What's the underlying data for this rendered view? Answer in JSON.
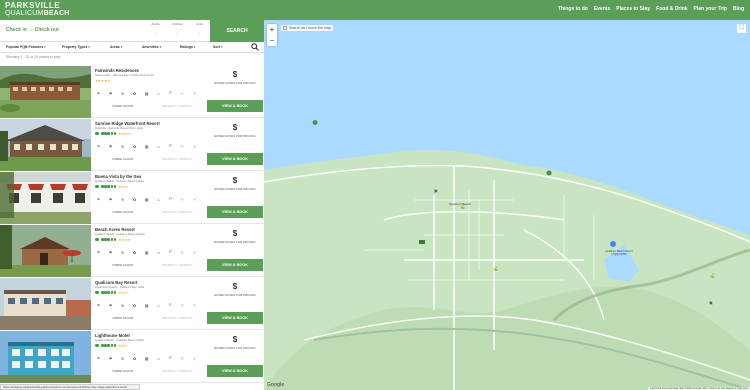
{
  "header": {
    "logo_line1": "PARKSVILLE",
    "logo_line2_a": "QUALICUM",
    "logo_line2_b": "BEACH",
    "nav": [
      "Things to do",
      "Events",
      "Places to Stay",
      "Food & Drink",
      "Plan your Trip",
      "Blog"
    ]
  },
  "search": {
    "checkin_label": "Check in → Check out",
    "guests": [
      {
        "label": "Adults",
        "value": "-"
      },
      {
        "label": "Children",
        "value": "-"
      },
      {
        "label": "Units",
        "value": "-"
      }
    ],
    "button": "SEARCH"
  },
  "filters": [
    {
      "label": "Popular PQB Features"
    },
    {
      "label": "Property Types"
    },
    {
      "label": "Areas"
    },
    {
      "label": "Amenities"
    },
    {
      "label": "Ratings"
    },
    {
      "label": "Sort"
    }
  ],
  "showing": "Showing 1 - 20 of 29 places to stay",
  "cards": [
    {
      "name": "Fairwinds Residences",
      "sub": "Nanoose Bay · Nanoose Bay | Condominium Hotel",
      "stars": "★★★★½",
      "dots": [
        1,
        1,
        1,
        1,
        1
      ],
      "scoop": "INSIDE SCOOP",
      "web": "PROPERTY WEBSITE",
      "price": "$",
      "enter": "ENTER DATES FOR PRICING",
      "book": "VIEW & BOOK"
    },
    {
      "name": "Sunrise Ridge Waterfront Resort",
      "sub": "Parksville · Parksville Resort Drive | Hotel",
      "stars": "★★★½",
      "dots": [
        1,
        1,
        1,
        1,
        0
      ],
      "scoop": "INSIDE SCOOP",
      "web": "PROPERTY WEBSITE",
      "price": "$",
      "enter": "ENTER DATES FOR PRICING",
      "book": "VIEW & BOOK"
    },
    {
      "name": "Buena Vista by the Sea",
      "sub": "Qualicum Beach · Qualicum Beach | Motel",
      "stars": "★★½",
      "dots": [
        1,
        1,
        1,
        1,
        0
      ],
      "scoop": "INSIDE SCOOP",
      "web": "PROPERTY WEBSITE",
      "price": "$",
      "enter": "ENTER DATES FOR PRICING",
      "book": "VIEW & BOOK"
    },
    {
      "name": "Beach Acres Resort",
      "sub": "Qualicum Beach · Qualicum Beach | Resort",
      "stars": "★★★★",
      "dots": [
        1,
        1,
        1,
        1,
        1
      ],
      "scoop": "INSIDE SCOOP",
      "web": "PROPERTY WEBSITE",
      "price": "$",
      "enter": "ENTER DATES FOR PRICING",
      "book": "VIEW & BOOK"
    },
    {
      "name": "Qualicum Bay Resort",
      "sub": "Lighthouse Country · Qualicum Bay | Hotel",
      "stars": "★★½",
      "dots": [
        1,
        1,
        1,
        1,
        0
      ],
      "scoop": "INSIDE SCOOP",
      "web": "PROPERTY WEBSITE",
      "price": "$",
      "enter": "ENTER DATES FOR PRICING",
      "book": "VIEW & BOOK"
    },
    {
      "name": "Lighthouse Motel",
      "sub": "Qualicum Beach · Qualicum Beach | Motel",
      "stars": "★★½",
      "dots": [
        1,
        1,
        1,
        0,
        0
      ],
      "scoop": "INSIDE SCOOP",
      "web": "PROPERTY WEBSITE",
      "price": "$",
      "enter": "ENTER DATES FOR PRICING",
      "book": "VIEW & BOOK"
    }
  ],
  "map": {
    "checkbox_label": "Search as I move the map",
    "zoom_in": "+",
    "zoom_out": "−",
    "google": "Google",
    "attribution": "Keyboard shortcuts   Map data ©2023 Google   200 m   Terms of Use   Report a map error",
    "town_label": "Qualicum Beach",
    "park_label": "Qualicum Beach Airport (YQQ/CAT8)"
  },
  "status_url": "https://lodging.visitparksvillequalicumbeach.com/property/4761/sunrise-ridge-waterfront-resort",
  "colors": {
    "brand": "#5a9e58",
    "water": "#aadaff",
    "land": "#c9e4c1",
    "road": "#ffffff"
  }
}
